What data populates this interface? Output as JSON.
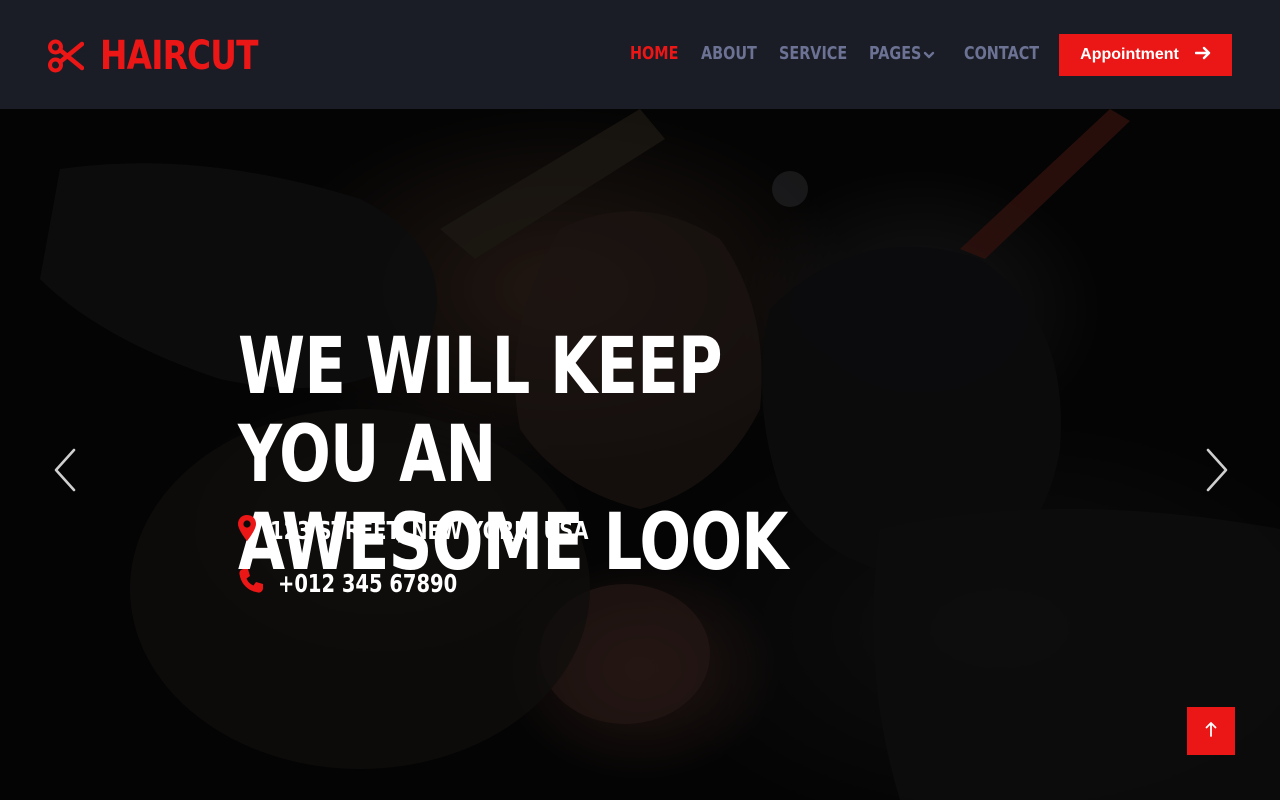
{
  "colors": {
    "accent": "#eb1616",
    "navbar_bg": "#1a1c26",
    "nav_link": "#6c7293",
    "text_light": "#ffffff"
  },
  "brand": {
    "name": "HAIRCUT",
    "icon": "scissors-icon"
  },
  "nav": {
    "items": [
      {
        "label": "HOME",
        "active": true
      },
      {
        "label": "ABOUT",
        "active": false
      },
      {
        "label": "SERVICE",
        "active": false
      },
      {
        "label": "PAGES",
        "active": false,
        "has_dropdown": true,
        "icon": "chevron-down-icon"
      },
      {
        "label": "CONTACT",
        "active": false
      }
    ],
    "cta": {
      "label": "Appointment",
      "icon": "arrow-right-icon"
    }
  },
  "hero": {
    "title_line1": "WE WILL KEEP YOU AN",
    "title_line2": "AWESOME LOOK",
    "address": {
      "text": "123 STREET, NEW YORK, USA",
      "icon": "map-marker-icon"
    },
    "phone": {
      "text": "+012 345 67890",
      "icon": "phone-icon"
    },
    "prev_icon": "chevron-left-icon",
    "next_icon": "chevron-right-icon"
  },
  "back_to_top": {
    "icon": "arrow-up-icon"
  }
}
